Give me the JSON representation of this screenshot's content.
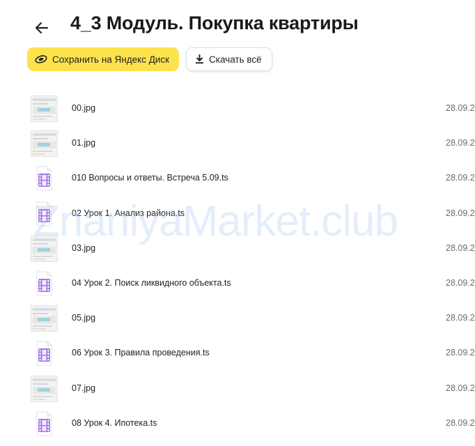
{
  "header": {
    "title": "4_3 Модуль. Покупка квартиры"
  },
  "actions": {
    "save_label": "Сохранить на Яндекс Диск",
    "download_label": "Скачать всё"
  },
  "files": [
    {
      "name": "00.jpg",
      "date": "28.09.2",
      "kind": "image",
      "icon": "image-thumbnail"
    },
    {
      "name": "01.jpg",
      "date": "28.09.2",
      "kind": "image",
      "icon": "image-thumbnail"
    },
    {
      "name": "010 Вопросы и ответы. Встреча 5.09.ts",
      "date": "28.09.2",
      "kind": "video",
      "icon": "video-file-icon"
    },
    {
      "name": "02 Урок 1. Анализ района.ts",
      "date": "28.09.2",
      "kind": "video",
      "icon": "video-file-icon"
    },
    {
      "name": "03.jpg",
      "date": "28.09.2",
      "kind": "image",
      "icon": "image-thumbnail"
    },
    {
      "name": "04 Урок 2. Поиск ликвидного объекта.ts",
      "date": "28.09.2",
      "kind": "video",
      "icon": "video-file-icon"
    },
    {
      "name": "05.jpg",
      "date": "28.09.2",
      "kind": "image",
      "icon": "image-thumbnail"
    },
    {
      "name": "06 Урок 3. Правила проведения.ts",
      "date": "28.09.2",
      "kind": "video",
      "icon": "video-file-icon"
    },
    {
      "name": "07.jpg",
      "date": "28.09.2",
      "kind": "image",
      "icon": "image-thumbnail"
    },
    {
      "name": "08 Урок 4. Ипотека.ts",
      "date": "28.09.2",
      "kind": "video",
      "icon": "video-file-icon"
    }
  ],
  "watermark": "ZnaniyaMarket.club",
  "colors": {
    "accent": "#fce34d",
    "video_icon": "#a577e8",
    "date_text": "#6b6b6b"
  }
}
